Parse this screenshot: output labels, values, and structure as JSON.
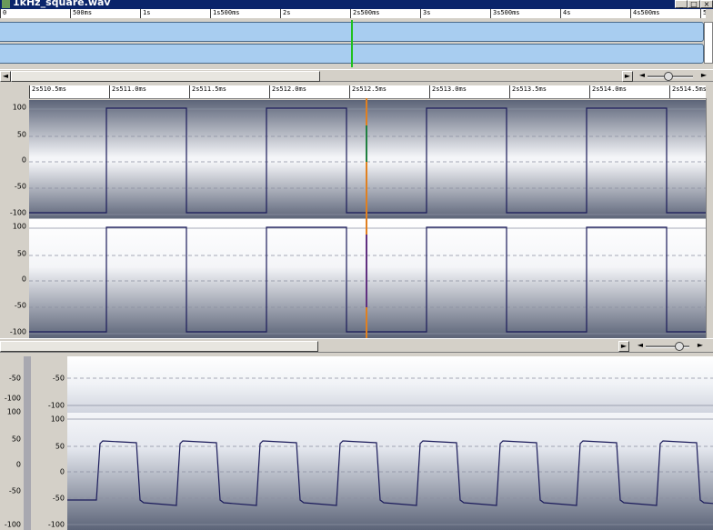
{
  "window": {
    "title": "1kHz_square.wav"
  },
  "overview": {
    "ruler_ticks": [
      "0",
      "500ms",
      "1s",
      "1s500ms",
      "2s",
      "2s500ms",
      "3s",
      "3s500ms",
      "4s",
      "4s500ms",
      "5s"
    ]
  },
  "main": {
    "ruler_ticks": [
      "2s510.5ms",
      "2s511.0ms",
      "2s511.5ms",
      "2s512.0ms",
      "2s512.5ms",
      "2s513.0ms",
      "2s513.5ms",
      "2s514.0ms",
      "2s514.5ms"
    ],
    "y_ticks": [
      "100",
      "50",
      "0",
      "-50",
      "-100"
    ]
  },
  "lower": {
    "top_ticks": [
      "-50",
      "-100"
    ],
    "left_ticks": [
      "-50",
      "-100",
      "100",
      "50",
      "0",
      "-50",
      "-100"
    ],
    "ch_ticks": [
      "100",
      "50",
      "0",
      "-50",
      "-100"
    ]
  },
  "colors": {
    "wave": "#1a1a5a",
    "cursor": "#e08020",
    "playhead": "#20c020"
  },
  "icons": {
    "scroll_left": "◄",
    "scroll_right": "►",
    "close": "×"
  }
}
